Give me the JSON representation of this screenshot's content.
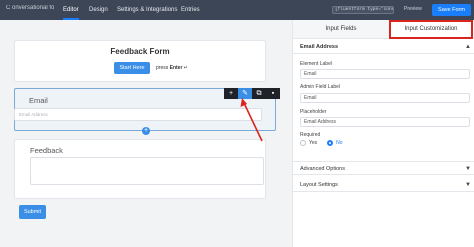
{
  "topbar": {
    "breadcrumb": "C onversational fo...",
    "tabs": [
      "Editor",
      "Design",
      "Settings & Integrations",
      "Entries"
    ],
    "shortcode": "[fluentform type=\"conversi",
    "preview_label": "Preview",
    "save_label": "Save Form"
  },
  "form": {
    "title": "Feedback Form",
    "start_label": "Start Here",
    "press_prefix": "press",
    "press_key": "Enter",
    "press_symbol": "↵",
    "email_label": "Email",
    "email_placeholder": "Email Address",
    "feedback_label": "Feedback",
    "submit_label": "Submit",
    "toolbar": {
      "add": "+",
      "edit": "✎",
      "copy": "⧉",
      "delete": "▪"
    },
    "add_field": "+"
  },
  "panel": {
    "tabs": [
      "Input Fields",
      "Input Customization"
    ],
    "section_title": "Email Address",
    "element_label_caption": "Element Label",
    "element_label_value": "Email",
    "admin_label_caption": "Admin Field Label",
    "admin_label_value": "Email",
    "placeholder_caption": "Placeholder",
    "placeholder_value": "Email Address",
    "required_caption": "Required",
    "required_options": [
      "Yes",
      "No"
    ],
    "required_selected": "No",
    "advanced": "Advanced Options",
    "layout": "Layout Settings"
  },
  "colors": {
    "accent": "#1a7efb",
    "topbar": "#3d4656",
    "highlight": "#d9251d"
  }
}
